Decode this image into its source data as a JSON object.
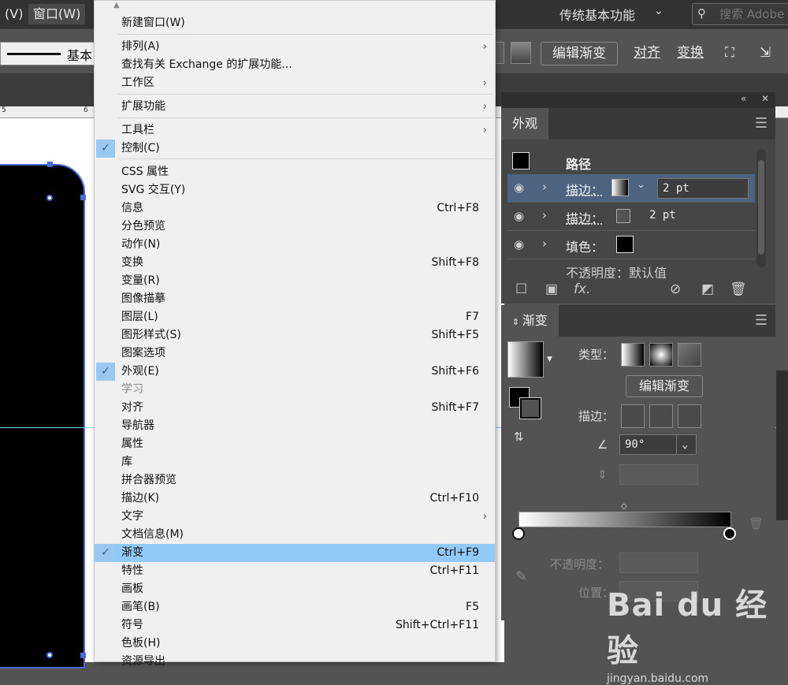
{
  "menubar": {
    "view": "(V)",
    "window": "窗口(W)",
    "workspace": "传统基本功能",
    "search_placeholder": "搜索 Adobe"
  },
  "control": {
    "stroke_style": "基本",
    "edit_gradient": "编辑渐变",
    "align": "对齐",
    "transform": "变换"
  },
  "menu": {
    "items": [
      {
        "label": "新建窗口(W)",
        "shortcut": "",
        "sub": false,
        "checked": false,
        "disabled": false
      },
      {
        "label": "排列(A)",
        "shortcut": "",
        "sub": true,
        "checked": false,
        "disabled": false
      },
      {
        "label": "查找有关 Exchange 的扩展功能...",
        "shortcut": "",
        "sub": false,
        "checked": false,
        "disabled": false
      },
      {
        "label": "工作区",
        "shortcut": "",
        "sub": true,
        "checked": false,
        "disabled": false
      },
      {
        "label": "扩展功能",
        "shortcut": "",
        "sub": true,
        "checked": false,
        "disabled": false
      },
      {
        "label": "工具栏",
        "shortcut": "",
        "sub": true,
        "checked": false,
        "disabled": false
      },
      {
        "label": "控制(C)",
        "shortcut": "",
        "sub": false,
        "checked": true,
        "disabled": false
      },
      {
        "label": "CSS 属性",
        "shortcut": "",
        "sub": false,
        "checked": false,
        "disabled": false
      },
      {
        "label": "SVG 交互(Y)",
        "shortcut": "",
        "sub": false,
        "checked": false,
        "disabled": false
      },
      {
        "label": "信息",
        "shortcut": "Ctrl+F8",
        "sub": false,
        "checked": false,
        "disabled": false
      },
      {
        "label": "分色预览",
        "shortcut": "",
        "sub": false,
        "checked": false,
        "disabled": false
      },
      {
        "label": "动作(N)",
        "shortcut": "",
        "sub": false,
        "checked": false,
        "disabled": false
      },
      {
        "label": "变换",
        "shortcut": "Shift+F8",
        "sub": false,
        "checked": false,
        "disabled": false
      },
      {
        "label": "变量(R)",
        "shortcut": "",
        "sub": false,
        "checked": false,
        "disabled": false
      },
      {
        "label": "图像描摹",
        "shortcut": "",
        "sub": false,
        "checked": false,
        "disabled": false
      },
      {
        "label": "图层(L)",
        "shortcut": "F7",
        "sub": false,
        "checked": false,
        "disabled": false
      },
      {
        "label": "图形样式(S)",
        "shortcut": "Shift+F5",
        "sub": false,
        "checked": false,
        "disabled": false
      },
      {
        "label": "图案选项",
        "shortcut": "",
        "sub": false,
        "checked": false,
        "disabled": false
      },
      {
        "label": "外观(E)",
        "shortcut": "Shift+F6",
        "sub": false,
        "checked": true,
        "disabled": false
      },
      {
        "label": "学习",
        "shortcut": "",
        "sub": false,
        "checked": false,
        "disabled": true
      },
      {
        "label": "对齐",
        "shortcut": "Shift+F7",
        "sub": false,
        "checked": false,
        "disabled": false
      },
      {
        "label": "导航器",
        "shortcut": "",
        "sub": false,
        "checked": false,
        "disabled": false
      },
      {
        "label": "属性",
        "shortcut": "",
        "sub": false,
        "checked": false,
        "disabled": false
      },
      {
        "label": "库",
        "shortcut": "",
        "sub": false,
        "checked": false,
        "disabled": false
      },
      {
        "label": "拼合器预览",
        "shortcut": "",
        "sub": false,
        "checked": false,
        "disabled": false
      },
      {
        "label": "描边(K)",
        "shortcut": "Ctrl+F10",
        "sub": false,
        "checked": false,
        "disabled": false
      },
      {
        "label": "文字",
        "shortcut": "",
        "sub": true,
        "checked": false,
        "disabled": false
      },
      {
        "label": "文档信息(M)",
        "shortcut": "",
        "sub": false,
        "checked": false,
        "disabled": false
      },
      {
        "label": "渐变",
        "shortcut": "Ctrl+F9",
        "sub": false,
        "checked": true,
        "disabled": false,
        "highlighted": true
      },
      {
        "label": "特性",
        "shortcut": "Ctrl+F11",
        "sub": false,
        "checked": false,
        "disabled": false
      },
      {
        "label": "画板",
        "shortcut": "",
        "sub": false,
        "checked": false,
        "disabled": false
      },
      {
        "label": "画笔(B)",
        "shortcut": "F5",
        "sub": false,
        "checked": false,
        "disabled": false
      },
      {
        "label": "符号",
        "shortcut": "Shift+Ctrl+F11",
        "sub": false,
        "checked": false,
        "disabled": false
      },
      {
        "label": "色板(H)",
        "shortcut": "",
        "sub": false,
        "checked": false,
        "disabled": false
      },
      {
        "label": "资源导出",
        "shortcut": "",
        "sub": false,
        "checked": false,
        "disabled": false
      }
    ]
  },
  "appearance": {
    "tab": "外观",
    "object": "路径",
    "rows": [
      {
        "label": "描边：",
        "value": "2 pt"
      },
      {
        "label": "描边：",
        "value": "2 pt"
      },
      {
        "label": "填色：",
        "value": ""
      },
      {
        "label": "不透明度：默认值",
        "value": ""
      }
    ]
  },
  "gradient": {
    "tab": "渐变",
    "type_label": "类型：",
    "edit_button": "编辑渐变",
    "stroke_label": "描边：",
    "angle": "90°",
    "opacity_label": "不透明度：",
    "position_label": "位置："
  },
  "watermark": {
    "brand": "Bai du 经验",
    "url": "jingyan.baidu.com"
  }
}
